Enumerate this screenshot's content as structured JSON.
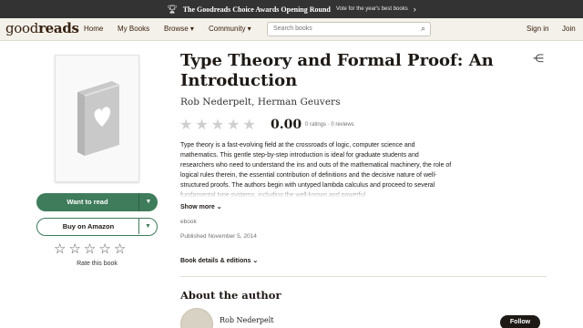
{
  "banner": {
    "icon": "trophy-icon",
    "title": "The Goodreads Choice Awards Opening Round",
    "subtitle": "Vote for the year's best books"
  },
  "nav": {
    "logo_light": "good",
    "logo_bold": "reads",
    "items": [
      "Home",
      "My Books",
      "Browse ▾",
      "Community ▾"
    ],
    "search_placeholder": "Search books",
    "sign_in": "Sign in",
    "join": "Join"
  },
  "book": {
    "title": "Type Theory and Formal Proof: An Introduction",
    "authors": "Rob Nederpelt, Herman Geuvers",
    "average_rating": "0.00",
    "rating_counts": "0 ratings · 0 reviews",
    "stars_filled": 0,
    "description": "Type theory is a fast-evolving field at the crossroads of logic, computer science and mathematics. This gentle step-by-step introduction is ideal for graduate students and researchers who need to understand the ins and outs of the mathematical machinery, the role of logical rules therein, the essential contribution of definitions and the decisive nature of well-structured proofs. The authors begin with untyped lambda calculus and proceed to several fundamental type systems, including the well-known and powerful",
    "show_more": "Show more",
    "format": "ebook",
    "published": "Published November 5, 2014",
    "details_link": "Book details & editions"
  },
  "actions": {
    "want_to_read": "Want to read",
    "buy": "Buy on Amazon",
    "rate_label": "Rate this book"
  },
  "about": {
    "heading": "About the author",
    "author_name": "Rob Nederpelt",
    "follow": "Follow"
  },
  "colors": {
    "brand_green": "#3f7c5b",
    "nav_background": "#f4f1ea",
    "banner_background": "#333333"
  }
}
